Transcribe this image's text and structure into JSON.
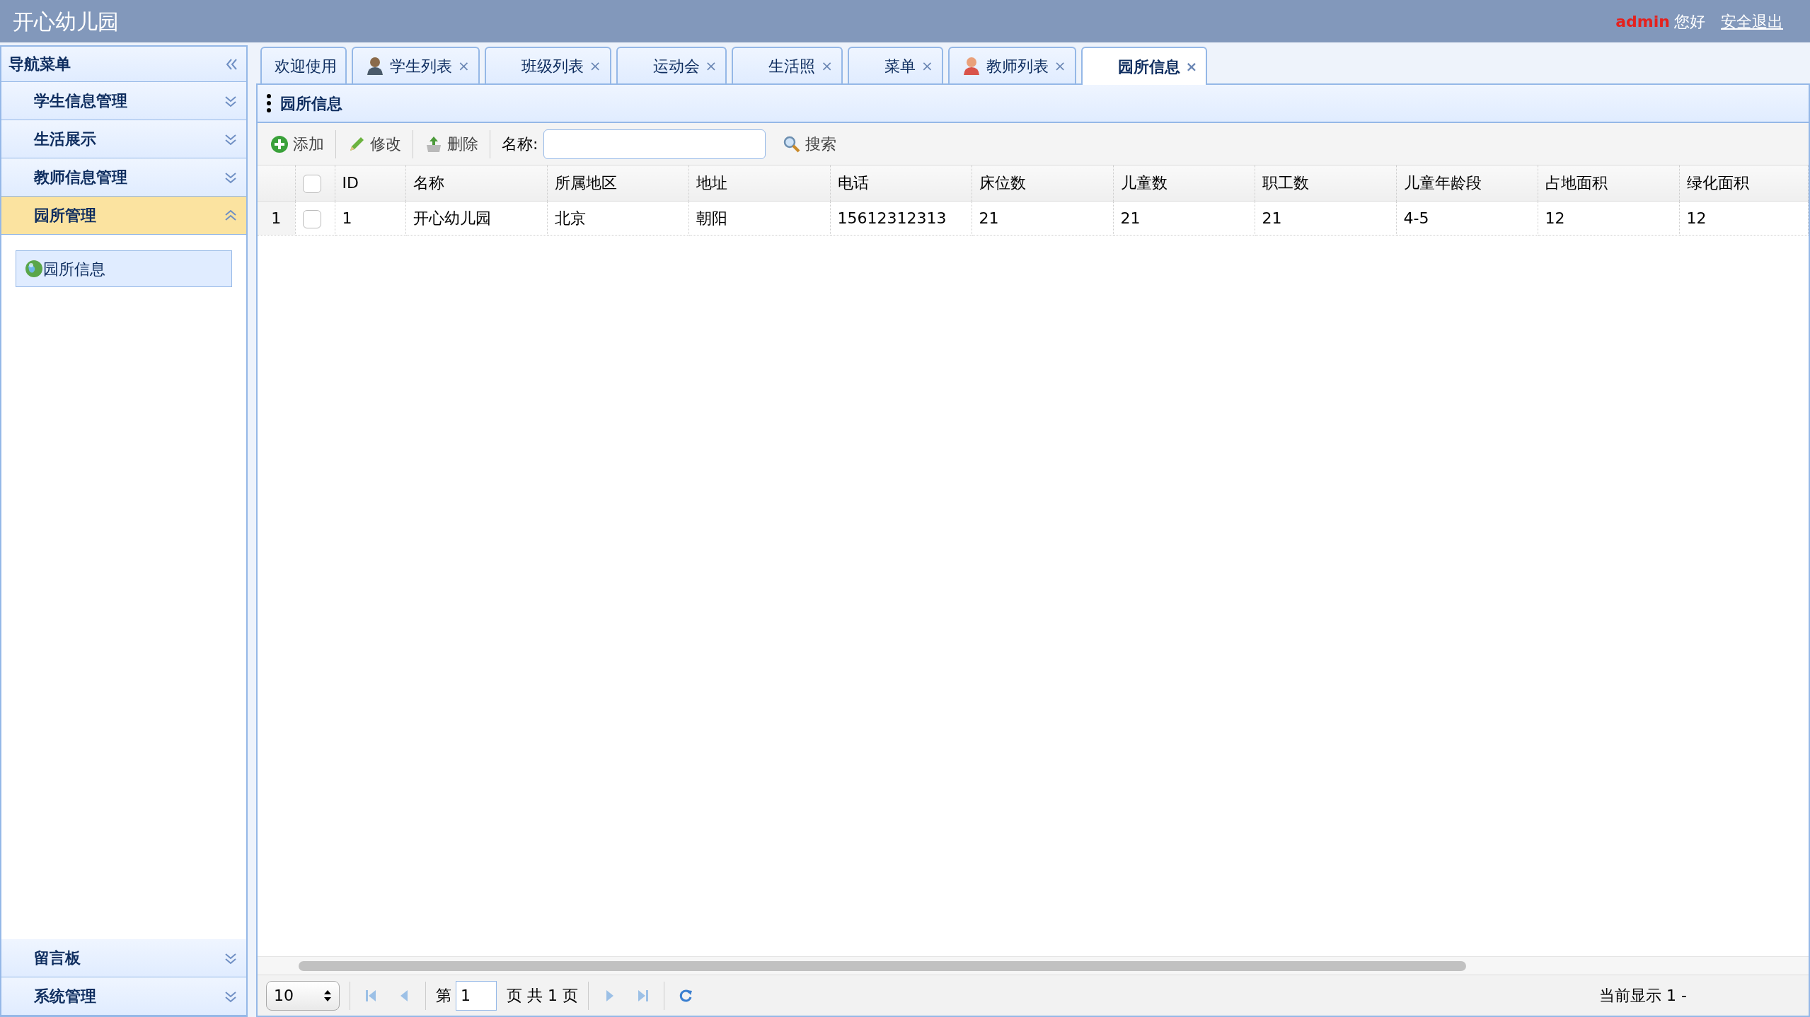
{
  "header": {
    "title": "开心幼儿园",
    "user": "admin",
    "greeting": "您好",
    "logout": "安全退出"
  },
  "sidebar": {
    "title": "导航菜单",
    "groups": [
      {
        "label": "学生信息管理",
        "expanded": false
      },
      {
        "label": "生活展示",
        "expanded": false
      },
      {
        "label": "教师信息管理",
        "expanded": false
      },
      {
        "label": "园所管理",
        "expanded": true,
        "items": [
          {
            "label": "园所信息",
            "selected": true
          }
        ]
      },
      {
        "label": "留言板",
        "expanded": false
      },
      {
        "label": "系统管理",
        "expanded": false
      }
    ]
  },
  "tabs": [
    {
      "label": "欢迎使用",
      "kind": "plain",
      "closable": false,
      "selected": false
    },
    {
      "label": "学生列表",
      "kind": "student",
      "closable": true,
      "selected": false
    },
    {
      "label": "班级列表",
      "kind": "plain",
      "closable": true,
      "selected": false
    },
    {
      "label": "运动会",
      "kind": "plain",
      "closable": true,
      "selected": false
    },
    {
      "label": "生活照",
      "kind": "plain",
      "closable": true,
      "selected": false
    },
    {
      "label": "菜单",
      "kind": "plain",
      "closable": true,
      "selected": false
    },
    {
      "label": "教师列表",
      "kind": "teacher",
      "closable": true,
      "selected": false
    },
    {
      "label": "园所信息",
      "kind": "plain",
      "closable": true,
      "selected": true
    }
  ],
  "close_glyph": "×",
  "panel": {
    "title": "园所信息"
  },
  "toolbar": {
    "buttons": [
      {
        "label": "添加",
        "kind": "add"
      },
      {
        "label": "修改",
        "kind": "edit"
      },
      {
        "label": "删除",
        "kind": "delete"
      }
    ],
    "search_label": "名称:",
    "search_button": "搜索"
  },
  "table": {
    "header_checked": false,
    "columns": [
      "ID",
      "名称",
      "所属地区",
      "地址",
      "电话",
      "床位数",
      "儿童数",
      "职工数",
      "儿童年龄段",
      "占地面积",
      "绿化面积"
    ],
    "rows": [
      {
        "number": "1",
        "checked": false,
        "cells": [
          "1",
          "开心幼儿园",
          "北京",
          "朝阳",
          "15612312313",
          "21",
          "21",
          "21",
          "4-5",
          "12",
          "12"
        ]
      }
    ]
  },
  "pager": {
    "page_size": "10",
    "page_prefix": "第",
    "page": "1",
    "page_suffix": "页 共 1 页",
    "status": "当前显示 1 -"
  }
}
